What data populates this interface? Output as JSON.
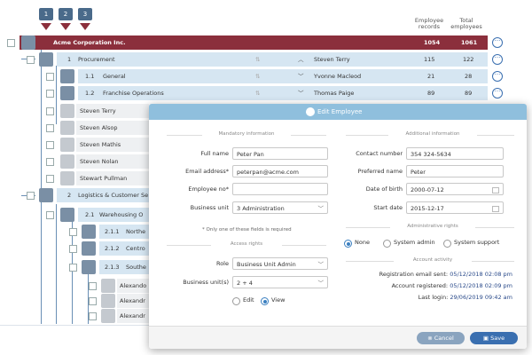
{
  "levels": [
    "1",
    "2",
    "3"
  ],
  "columns": {
    "employee_records": "Employee records",
    "total_employees": "Total employees"
  },
  "root": {
    "name": "Acme Corporation Inc.",
    "records": "1054",
    "total": "1061"
  },
  "tree": [
    {
      "num": "1",
      "name": "Procurement",
      "manager": "Steven Terry",
      "records": "115",
      "total": "122"
    },
    {
      "num": "1.1",
      "name": "General",
      "manager": "Yvonne Macleod",
      "records": "21",
      "total": "28"
    },
    {
      "num": "1.2",
      "name": "Franchise Operations",
      "manager": "Thomas Paige",
      "records": "89",
      "total": "89"
    }
  ],
  "employees_a": [
    "Steven Terry",
    "Steven Alsop",
    "Steven Mathis",
    "Steven Nolan",
    "Stewart Pullman"
  ],
  "tree2": [
    {
      "num": "2",
      "name": "Logistics & Customer Se"
    },
    {
      "num": "2.1",
      "name": "Warehousing O"
    },
    {
      "num": "2.1.1",
      "name": "Northe"
    },
    {
      "num": "2.1.2",
      "name": "Centro"
    },
    {
      "num": "2.1.3",
      "name": "Southe"
    }
  ],
  "employees_b": [
    "Alexando",
    "Alexandr",
    "Alexandr",
    "Alexandr"
  ],
  "modal": {
    "title": "Edit Employee",
    "mandatory_section": "Mandatory information",
    "additional_section": "Additional information",
    "full_name_label": "Full name",
    "full_name": "Peter Pan",
    "email_label": "Email address*",
    "email": "peterpan@acme.com",
    "employee_no_label": "Employee no*",
    "employee_no": "",
    "business_unit_label": "Business unit",
    "business_unit": "3 Administration",
    "required_note": "* Only one of these fields is required",
    "access_section": "Access rights",
    "role_label": "Role",
    "role": "Business Unit Admin",
    "business_units_label": "Business unit(s)",
    "business_units": "2 + 4",
    "edit_label": "Edit",
    "view_label": "View",
    "contact_label": "Contact number",
    "contact": "354 324-5634",
    "preferred_label": "Preferred name",
    "preferred": "Peter",
    "dob_label": "Date of birth",
    "dob": "2000-07-12",
    "start_label": "Start date",
    "start": "2015-12-17",
    "admin_section": "Administrative rights",
    "admin_none": "None",
    "admin_system": "System admin",
    "admin_support": "System support",
    "activity_section": "Account activity",
    "reg_label": "Registration email sent:",
    "reg_value": "05/12/2018 02:08 pm",
    "acc_label": "Account registered:",
    "acc_value": "05/12/2018 02:09 pm",
    "login_label": "Last login:",
    "login_value": "29/06/2019 09:42 am",
    "cancel": "Cancel",
    "save": "Save"
  },
  "colors": {
    "root_bar": "#8b2f3c",
    "row_blue": "#d6e6f2",
    "modal_header": "#8fbfdd",
    "save": "#3a6fb0",
    "cancel": "#8aa4bf"
  }
}
